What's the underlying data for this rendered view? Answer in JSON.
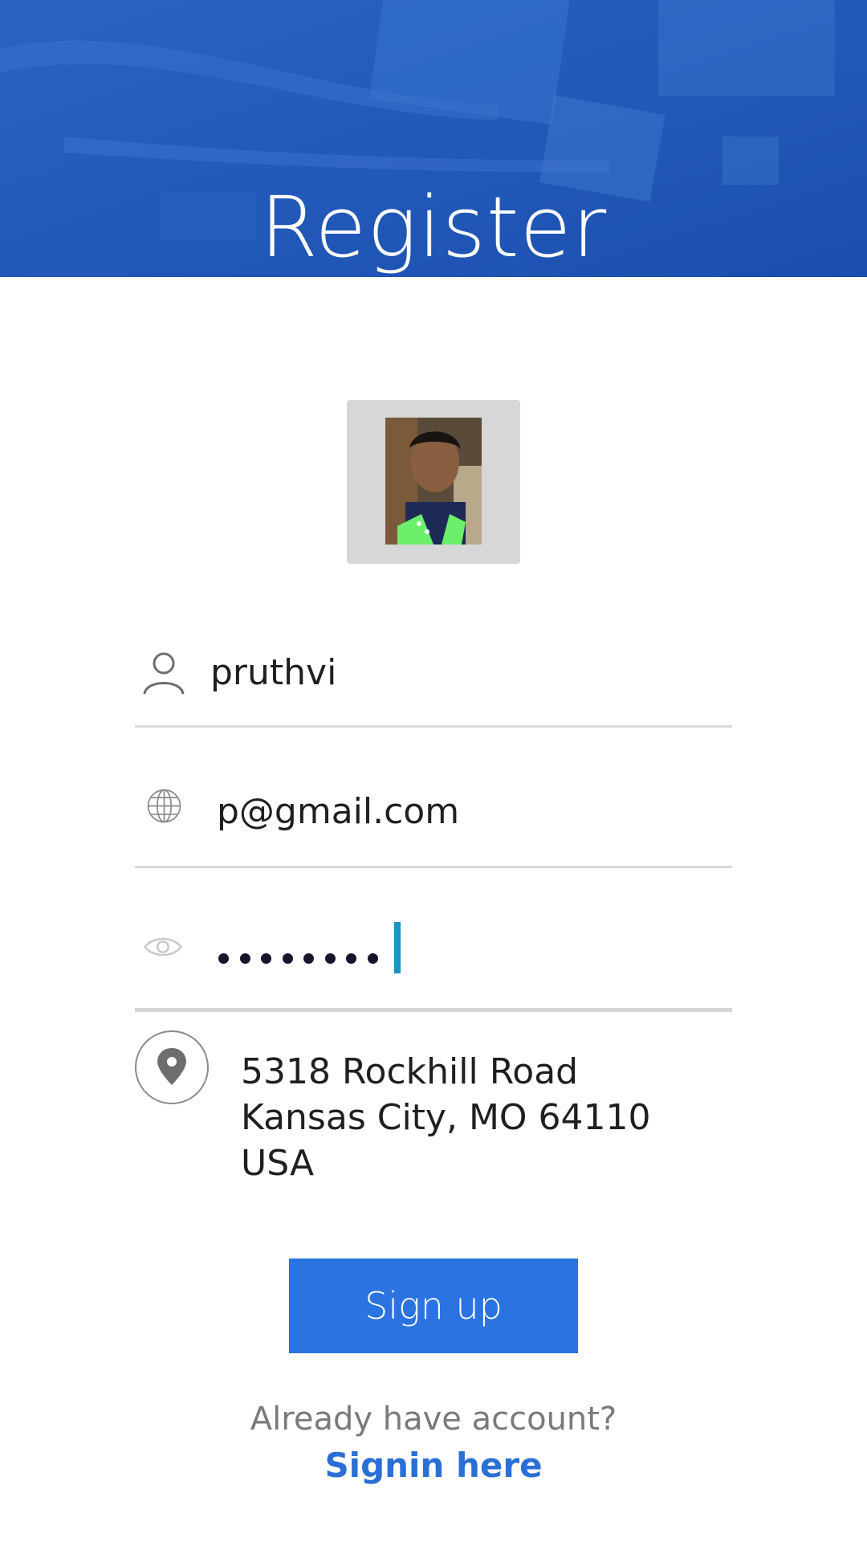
{
  "header": {
    "title": "Register",
    "background_color": "#1f55b5"
  },
  "avatar": {
    "icon": "profile-photo"
  },
  "form": {
    "name": {
      "value": "pruthvi",
      "icon": "user-icon"
    },
    "email": {
      "value": "p@gmail.com",
      "icon": "globe-icon"
    },
    "password": {
      "masked_length": 8,
      "icon": "eye-icon"
    }
  },
  "address": {
    "icon": "location-pin-icon",
    "line1": "5318 Rockhill Road",
    "line2": "Kansas City, MO 64110",
    "line3": "USA"
  },
  "actions": {
    "signup_label": "Sign up",
    "signup_color": "#2a73e0",
    "already_text": "Already have account?",
    "signin_label": "Signin here",
    "link_color": "#2a6fd6"
  }
}
